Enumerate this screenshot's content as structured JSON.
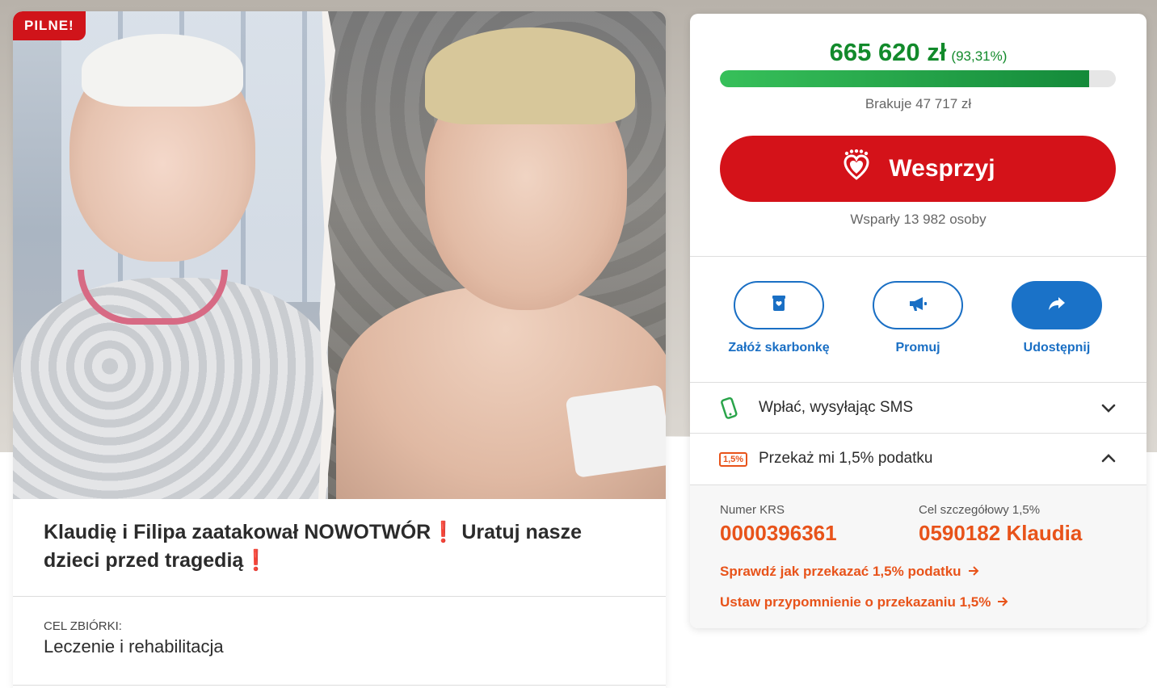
{
  "badge": "PILNE!",
  "title_parts": {
    "part1": "Klaudię i Filipa zaatakował NOWOTWÓR",
    "excl1": "❗",
    "part2": " Uratuj nasze dzieci przed tragedią",
    "excl2": "❗"
  },
  "goal": {
    "label": "CEL ZBIÓRKI:",
    "value": "Leczenie i rehabilitacja"
  },
  "fundraiser": {
    "amount": "665 620 zł",
    "percent": "(93,31%)",
    "progress_fraction": 0.9331,
    "missing": "Brakuje 47 717 zł",
    "support_button": "Wesprzyj",
    "supporters": "Wsparły 13 982 osoby"
  },
  "actions": [
    {
      "label": "Załóż skarbonkę",
      "icon": "piggy-bank-icon"
    },
    {
      "label": "Promuj",
      "icon": "megaphone-icon"
    },
    {
      "label": "Udostępnij",
      "icon": "share-icon"
    }
  ],
  "sms": {
    "label": "Wpłać, wysyłając SMS",
    "icon": "phone-icon"
  },
  "tax": {
    "badge": "1,5%",
    "label": "Przekaż mi 1,5% podatku",
    "krs_label": "Numer KRS",
    "krs_value": "0000396361",
    "goal_label": "Cel szczegółowy 1,5%",
    "goal_value": "0590182 Klaudia",
    "link1": "Sprawdź jak przekazać 1,5% podatku",
    "link2": "Ustaw przypomnienie o przekazaniu 1,5%"
  },
  "colors": {
    "urgent": "#d0141a",
    "progress": "#148a3a",
    "link_blue": "#1a6fc4",
    "tax_orange": "#e8531a"
  }
}
